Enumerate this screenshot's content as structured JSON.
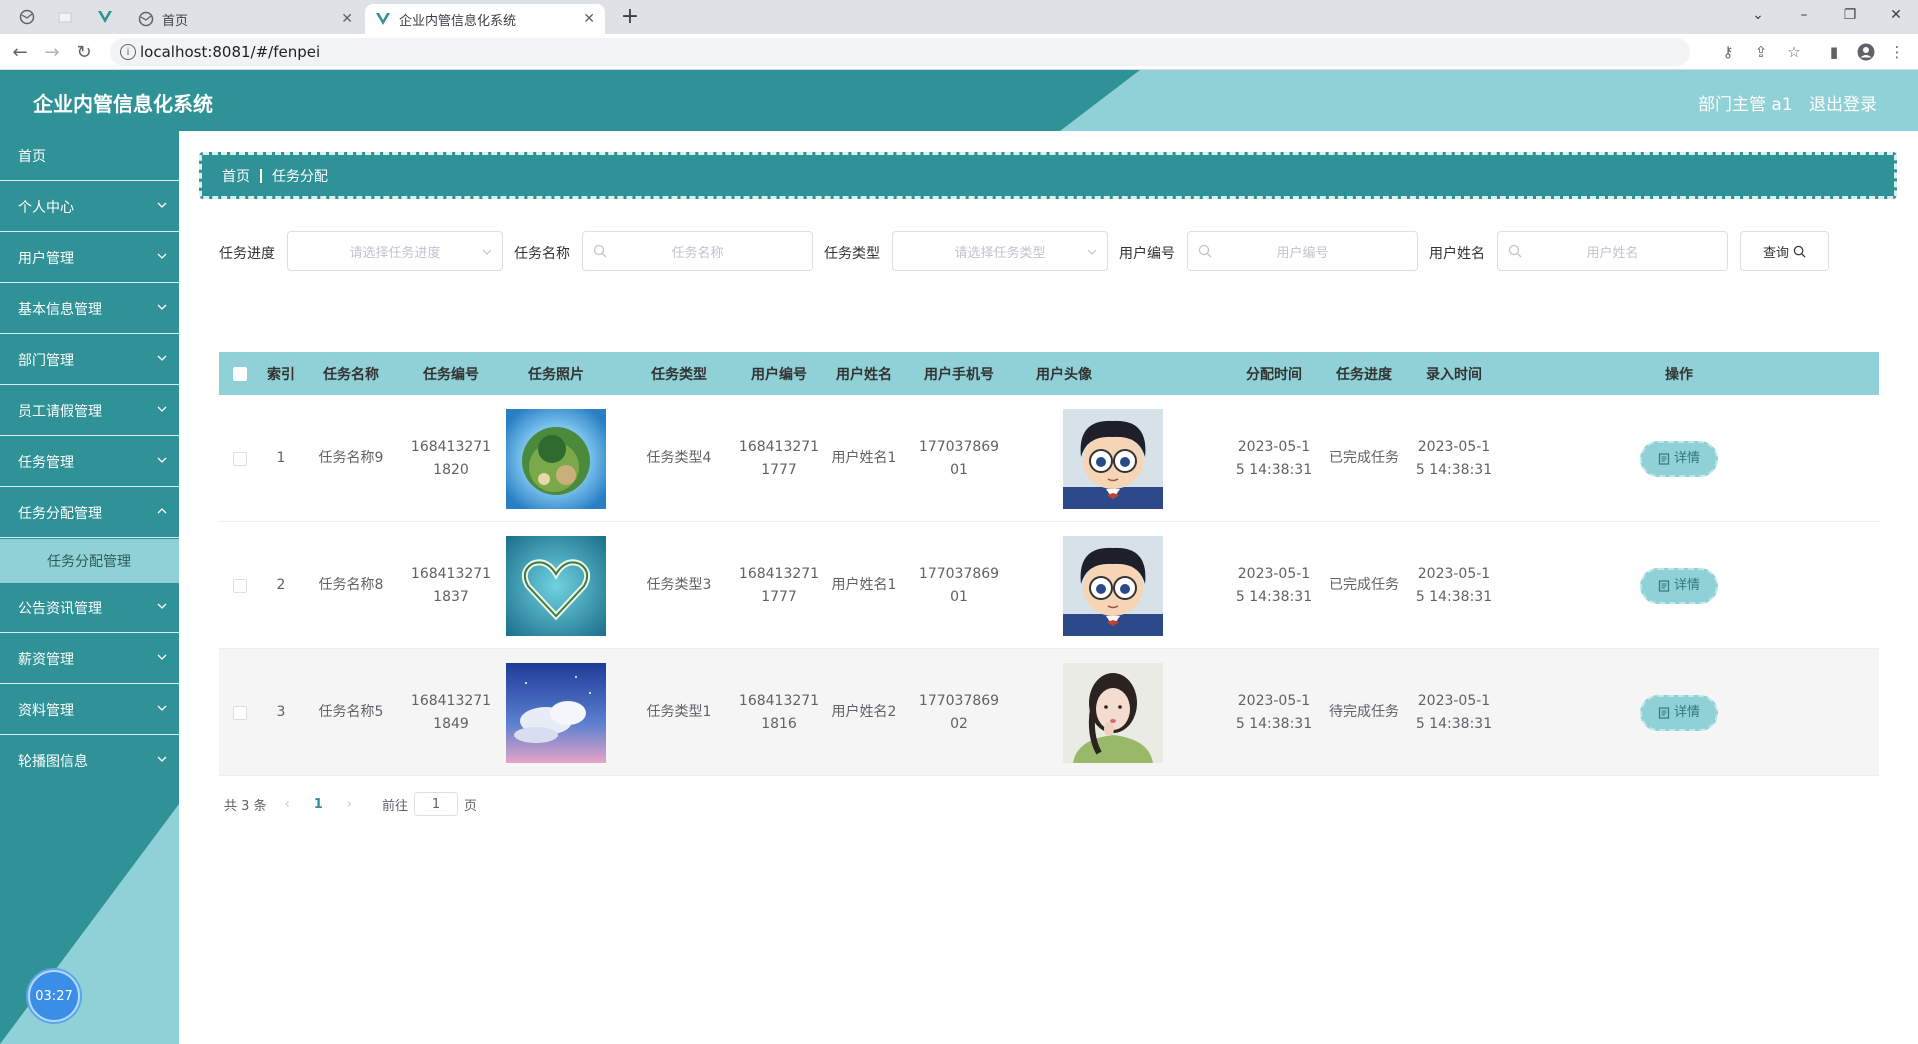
{
  "browser": {
    "tabs": [
      {
        "label": ""
      },
      {
        "label": ""
      },
      {
        "label": ""
      },
      {
        "label": "首页"
      },
      {
        "label": "企业内管信息化系统"
      }
    ],
    "url": "localhost:8081/#/fenpei"
  },
  "header": {
    "title": "企业内管信息化系统",
    "user": "部门主管 a1",
    "logout": "退出登录"
  },
  "sidebar": {
    "items": [
      {
        "label": "首页"
      },
      {
        "label": "个人中心"
      },
      {
        "label": "用户管理"
      },
      {
        "label": "基本信息管理"
      },
      {
        "label": "部门管理"
      },
      {
        "label": "员工请假管理"
      },
      {
        "label": "任务管理"
      },
      {
        "label": "任务分配管理"
      },
      {
        "label": "公告资讯管理"
      },
      {
        "label": "薪资管理"
      },
      {
        "label": "资料管理"
      },
      {
        "label": "轮播图信息"
      }
    ],
    "subitem": "任务分配管理",
    "timer": "03:27"
  },
  "breadcrumb": {
    "home": "首页",
    "current": "任务分配"
  },
  "filters": {
    "progress_label": "任务进度",
    "progress_placeholder": "请选择任务进度",
    "name_label": "任务名称",
    "name_placeholder": "任务名称",
    "type_label": "任务类型",
    "type_placeholder": "请选择任务类型",
    "userno_label": "用户编号",
    "userno_placeholder": "用户编号",
    "username_label": "用户姓名",
    "username_placeholder": "用户姓名",
    "query": "查询"
  },
  "table": {
    "headers": [
      "索引",
      "任务名称",
      "任务编号",
      "任务照片",
      "任务类型",
      "用户编号",
      "用户姓名",
      "用户手机号",
      "用户头像",
      "分配时间",
      "任务进度",
      "录入时间",
      "操作"
    ],
    "rows": [
      {
        "index": "1",
        "name": "任务名称9",
        "no_a": "168413271",
        "no_b": "1820",
        "photo": "planet-island-photo",
        "type": "任务类型4",
        "uno_a": "168413271",
        "uno_b": "1777",
        "uname": "用户姓名1",
        "phone_a": "177037869",
        "phone_b": "01",
        "avatar": "cartoon-boy-avatar",
        "assign_a": "2023-05-1",
        "assign_b": "5 14:38:31",
        "progress": "已完成任务",
        "entry_a": "2023-05-1",
        "entry_b": "5 14:38:31",
        "action": "详情"
      },
      {
        "index": "2",
        "name": "任务名称8",
        "no_a": "168413271",
        "no_b": "1837",
        "photo": "heart-island-photo",
        "type": "任务类型3",
        "uno_a": "168413271",
        "uno_b": "1777",
        "uname": "用户姓名1",
        "phone_a": "177037869",
        "phone_b": "01",
        "avatar": "cartoon-boy-avatar",
        "assign_a": "2023-05-1",
        "assign_b": "5 14:38:31",
        "progress": "已完成任务",
        "entry_a": "2023-05-1",
        "entry_b": "5 14:38:31",
        "action": "详情"
      },
      {
        "index": "3",
        "name": "任务名称5",
        "no_a": "168413271",
        "no_b": "1849",
        "photo": "sky-clouds-photo",
        "type": "任务类型1",
        "uno_a": "168413271",
        "uno_b": "1816",
        "uname": "用户姓名2",
        "phone_a": "177037869",
        "phone_b": "02",
        "avatar": "girl-portrait-avatar",
        "assign_a": "2023-05-1",
        "assign_b": "5 14:38:31",
        "progress": "待完成任务",
        "entry_a": "2023-05-1",
        "entry_b": "5 14:38:31",
        "action": "详情"
      }
    ]
  },
  "pagination": {
    "total": "共 3 条",
    "current": "1",
    "goto_label": "前往",
    "goto_value": "1",
    "page_suffix": "页"
  },
  "colors": {
    "primary": "#2e9297",
    "light": "#8fd1d6"
  }
}
